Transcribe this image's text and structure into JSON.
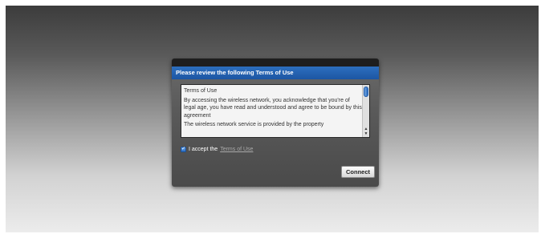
{
  "dialog": {
    "header": "Please review the following Terms of Use",
    "terms": {
      "title": "Terms of Use",
      "paragraph_1": "By accessing the wireless network, you acknowledge that you're of legal age, you have read and understood and agree to be bound by this agreement",
      "paragraph_2": "The wireless network service is provided by the property"
    },
    "accept": {
      "checked": true,
      "label": "I accept the",
      "link_text": "Terms of Use"
    },
    "connect_label": "Connect"
  },
  "icons": {
    "checkbox": "checkmark-icon",
    "scroll_up": "arrow-up-icon",
    "scroll_down": "arrow-down-icon"
  },
  "colors": {
    "header_blue": "#1c56a3",
    "link_gray": "#a9a9a9"
  }
}
